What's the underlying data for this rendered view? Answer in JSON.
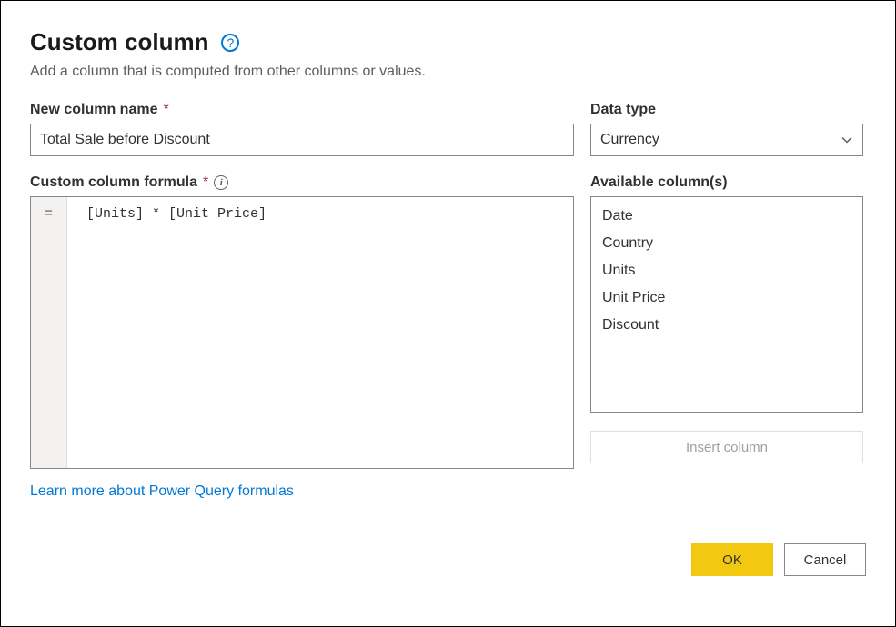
{
  "header": {
    "title": "Custom column",
    "subtitle": "Add a column that is computed from other columns or values."
  },
  "fields": {
    "name_label": "New column name",
    "name_value": "Total Sale before Discount",
    "datatype_label": "Data type",
    "datatype_value": "Currency",
    "formula_label": "Custom column formula",
    "formula_prefix": "=",
    "formula_value": " [Units] * [Unit Price]",
    "available_label": "Available column(s)"
  },
  "available_columns": [
    "Date",
    "Country",
    "Units",
    "Unit Price",
    "Discount"
  ],
  "buttons": {
    "insert": "Insert column",
    "learn_link": "Learn more about Power Query formulas",
    "ok": "OK",
    "cancel": "Cancel"
  }
}
